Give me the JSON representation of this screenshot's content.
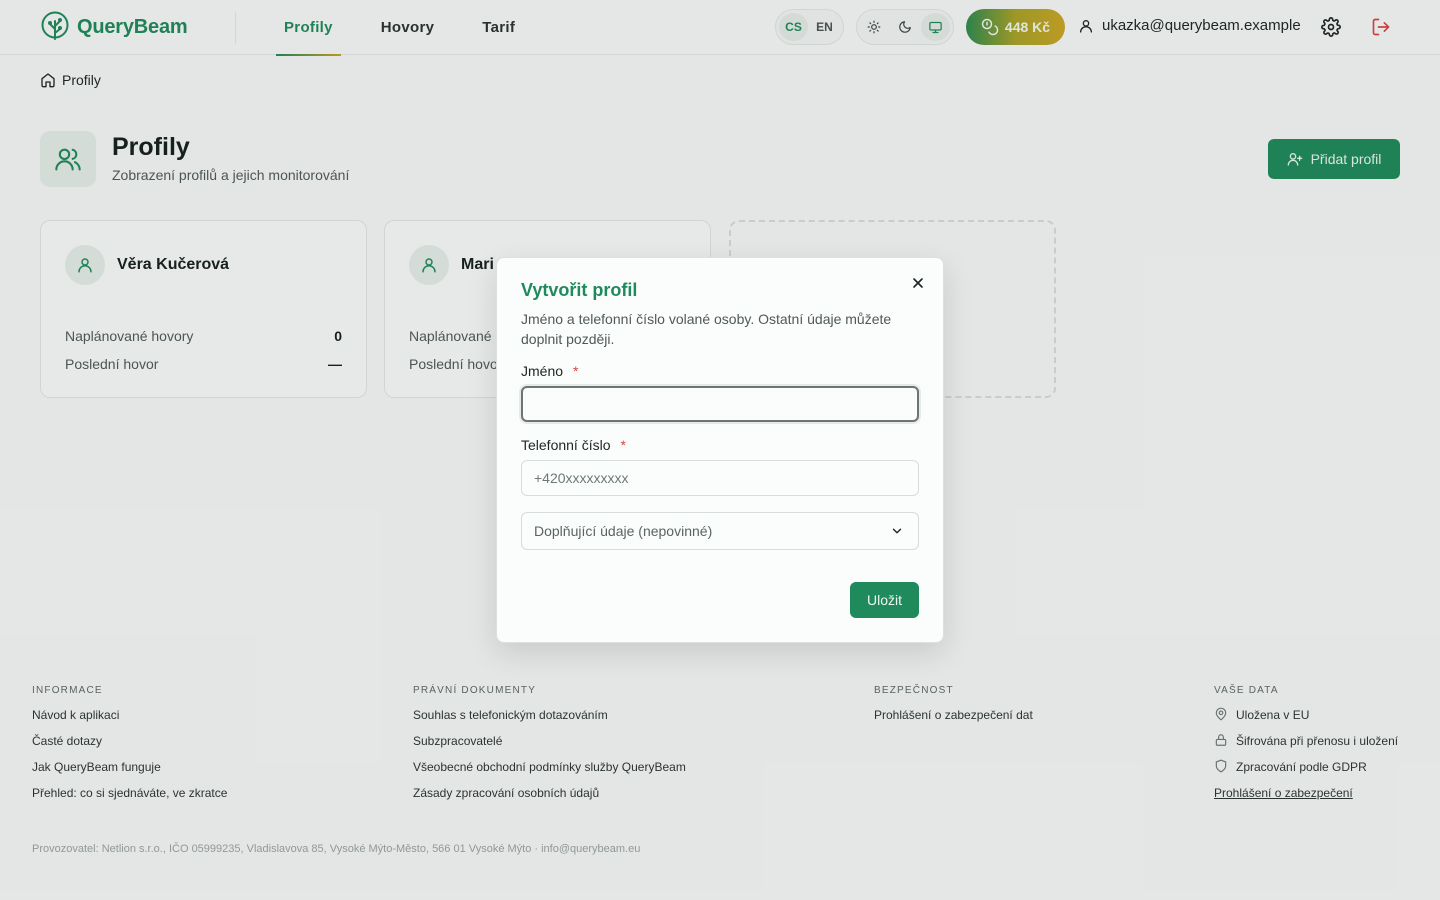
{
  "app": {
    "name": "QueryBeam"
  },
  "nav": {
    "tabs": [
      {
        "label": "Profily",
        "active": true
      },
      {
        "label": "Hovory",
        "active": false
      },
      {
        "label": "Tarif",
        "active": false
      }
    ]
  },
  "header": {
    "languages": [
      "CS",
      "EN"
    ],
    "active_language": "CS",
    "theme_options": [
      "light",
      "dark",
      "system"
    ],
    "active_theme": "system",
    "credit": "448 Kč",
    "user_email": "ukazka@querybeam.example"
  },
  "breadcrumb": {
    "current": "Profily"
  },
  "page": {
    "title": "Profily",
    "subtitle": "Zobrazení profilů a jejich monitorování",
    "add_button": "Přidat profil"
  },
  "profiles": [
    {
      "name": "Věra Kučerová",
      "scheduled_label": "Naplánované hovory",
      "scheduled_value": "0",
      "last_label": "Poslední hovor",
      "last_value": "—"
    },
    {
      "name": "Mari",
      "scheduled_label": "Naplánované",
      "scheduled_value": "",
      "last_label": "Poslední hovo",
      "last_value": ""
    }
  ],
  "modal": {
    "title": "Vytvořit profil",
    "description": "Jméno a telefonní číslo volané osoby. Ostatní údaje můžete doplnit později.",
    "name_label": "Jméno",
    "phone_label": "Telefonní číslo",
    "required_mark": "*",
    "name_value": "",
    "phone_placeholder": "+420xxxxxxxxx",
    "optional_section": "Doplňující údaje (nepovinné)",
    "save_button": "Uložit"
  },
  "footer": {
    "info": {
      "heading": "INFORMACE",
      "links": [
        "Návod k aplikaci",
        "Časté dotazy",
        "Jak QueryBeam funguje",
        "Přehled: co si sjednáváte, ve zkratce"
      ]
    },
    "legal": {
      "heading": "PRÁVNÍ DOKUMENTY",
      "links": [
        "Souhlas s telefonickým dotazováním",
        "Subzpracovatelé",
        "Všeobecné obchodní podmínky služby QueryBeam",
        "Zásady zpracování osobních údajů"
      ]
    },
    "security": {
      "heading": "BEZPEČNOST",
      "links": [
        "Prohlášení o zabezpečení dat"
      ]
    },
    "data": {
      "heading": "VAŠE DATA",
      "items": [
        "Uložena v EU",
        "Šifrována při přenosu i uložení",
        "Zpracování podle GDPR"
      ],
      "link": "Prohlášení o zabezpečení"
    },
    "operator": "Provozovatel: Netlion s.r.o., IČO 05999235, Vladislavova 85, Vysoké Mýto-Město, 566 01 Vysoké Mýto · info@querybeam.eu"
  },
  "colors": {
    "brand": "#1f8a5b",
    "accent_gold": "#c6a221",
    "required": "#d64545",
    "logout": "#d64545"
  }
}
